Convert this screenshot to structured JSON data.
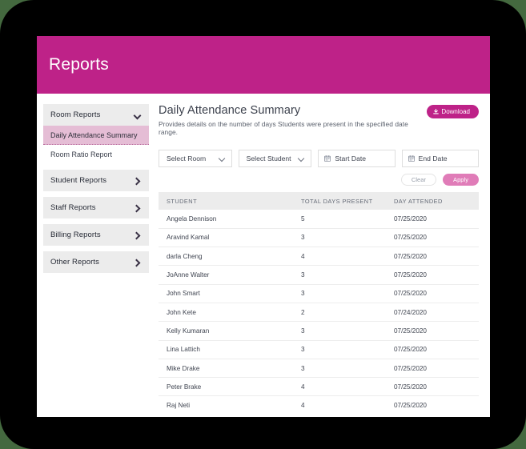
{
  "header": {
    "title": "Reports"
  },
  "sidebar": {
    "groups": [
      {
        "label": "Room Reports",
        "icon": "chevron-down-icon",
        "expanded": true,
        "items": [
          {
            "label": "Daily Attendance Summary",
            "active": true
          },
          {
            "label": "Room Ratio Report",
            "active": false
          }
        ]
      },
      {
        "label": "Student Reports",
        "icon": "chevron-right-icon",
        "expanded": false,
        "items": []
      },
      {
        "label": "Staff Reports",
        "icon": "chevron-right-icon",
        "expanded": false,
        "items": []
      },
      {
        "label": "Billing Reports",
        "icon": "chevron-right-icon",
        "expanded": false,
        "items": []
      },
      {
        "label": "Other Reports",
        "icon": "chevron-right-icon",
        "expanded": false,
        "items": []
      }
    ]
  },
  "main": {
    "report_title": "Daily Attendance Summary",
    "report_subtitle": "Provides details on the number of days Students were present in the specified date range.",
    "download_label": "Download",
    "download_icon": "download-icon",
    "filters": [
      {
        "type": "select",
        "value": "Select Room",
        "icon": "chevron-down-icon"
      },
      {
        "type": "select",
        "value": "Select Student",
        "icon": "chevron-down-icon"
      },
      {
        "type": "date",
        "value": "Start Date",
        "icon": "calendar-icon"
      },
      {
        "type": "date",
        "value": "End Date",
        "icon": "calendar-icon"
      }
    ],
    "clear_label": "Clear",
    "apply_label": "Apply",
    "table": {
      "columns": [
        "STUDENT",
        "TOTAL DAYS PRESENT",
        "DAY ATTENDED"
      ],
      "rows": [
        [
          "Angela Dennison",
          "5",
          "07/25/2020"
        ],
        [
          "Aravind Kamal",
          "3",
          "07/25/2020"
        ],
        [
          "darla Cheng",
          "4",
          "07/25/2020"
        ],
        [
          "JoAnne Walter",
          "3",
          "07/25/2020"
        ],
        [
          "John Smart",
          "3",
          "07/25/2020"
        ],
        [
          "John Kete",
          "2",
          "07/24/2020"
        ],
        [
          "Kelly Kumaran",
          "3",
          "07/25/2020"
        ],
        [
          "Lina Lattich",
          "3",
          "07/25/2020"
        ],
        [
          "Mike Drake",
          "3",
          "07/25/2020"
        ],
        [
          "Peter Brake",
          "4",
          "07/25/2020"
        ],
        [
          "Raj Neti",
          "4",
          "07/25/2020"
        ]
      ]
    }
  },
  "colors": {
    "brand_magenta": "#be2288",
    "apply_pink": "#e07cb8",
    "active_item_pink": "#e5bdd5",
    "header_gray": "#ececec",
    "page_backdrop": "#44693f"
  }
}
